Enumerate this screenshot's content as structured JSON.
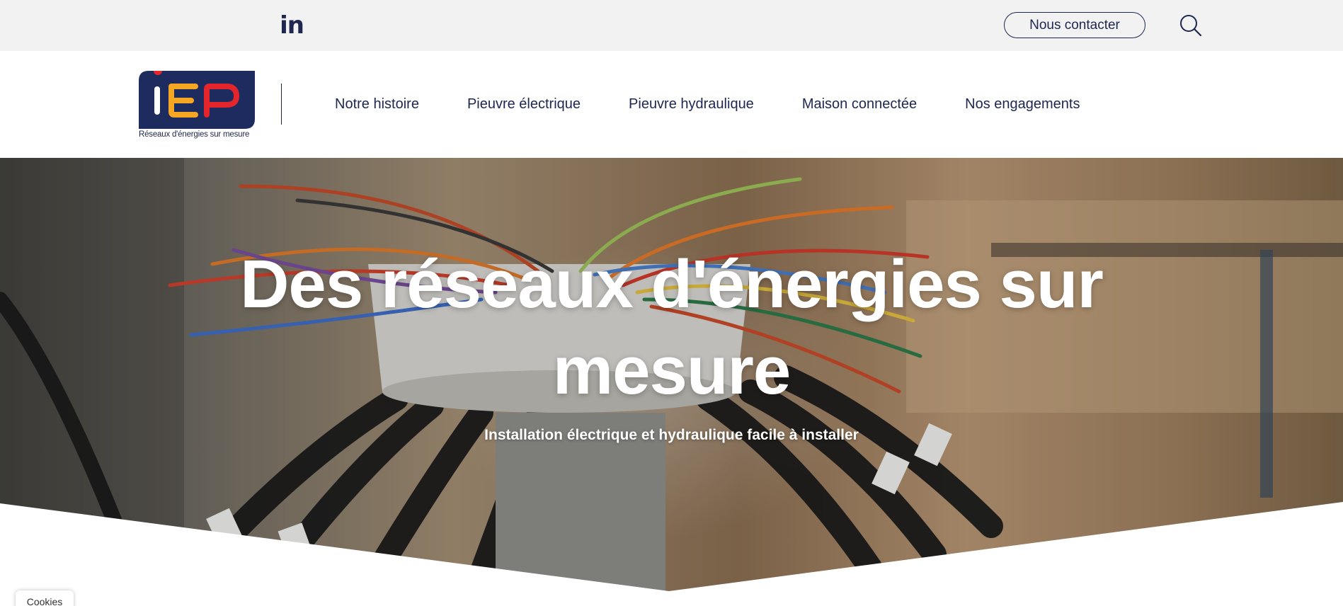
{
  "topbar": {
    "linkedin_label": "in",
    "contact_label": "Nous contacter",
    "search_icon": "search-icon"
  },
  "logo": {
    "brand": "IEP",
    "tagline": "Réseaux d'énergies sur mesure",
    "colors": {
      "background": "#1d2b5e",
      "dot": "#e4262c",
      "i": "#ffffff",
      "e": "#f5a623",
      "p": "#e4262c"
    }
  },
  "nav": {
    "items": [
      {
        "label": "Notre histoire"
      },
      {
        "label": "Pieuvre électrique"
      },
      {
        "label": "Pieuvre hydraulique"
      },
      {
        "label": "Maison connectée"
      },
      {
        "label": "Nos engagements"
      }
    ]
  },
  "hero": {
    "title": "Des réseaux d'énergies sur mesure",
    "subtitle": "Installation électrique et hydraulique facile à installer"
  },
  "cookies": {
    "label": "Cookies"
  },
  "colors": {
    "primary": "#1d2750",
    "topbar_bg": "#f2f2f2",
    "white": "#ffffff"
  }
}
